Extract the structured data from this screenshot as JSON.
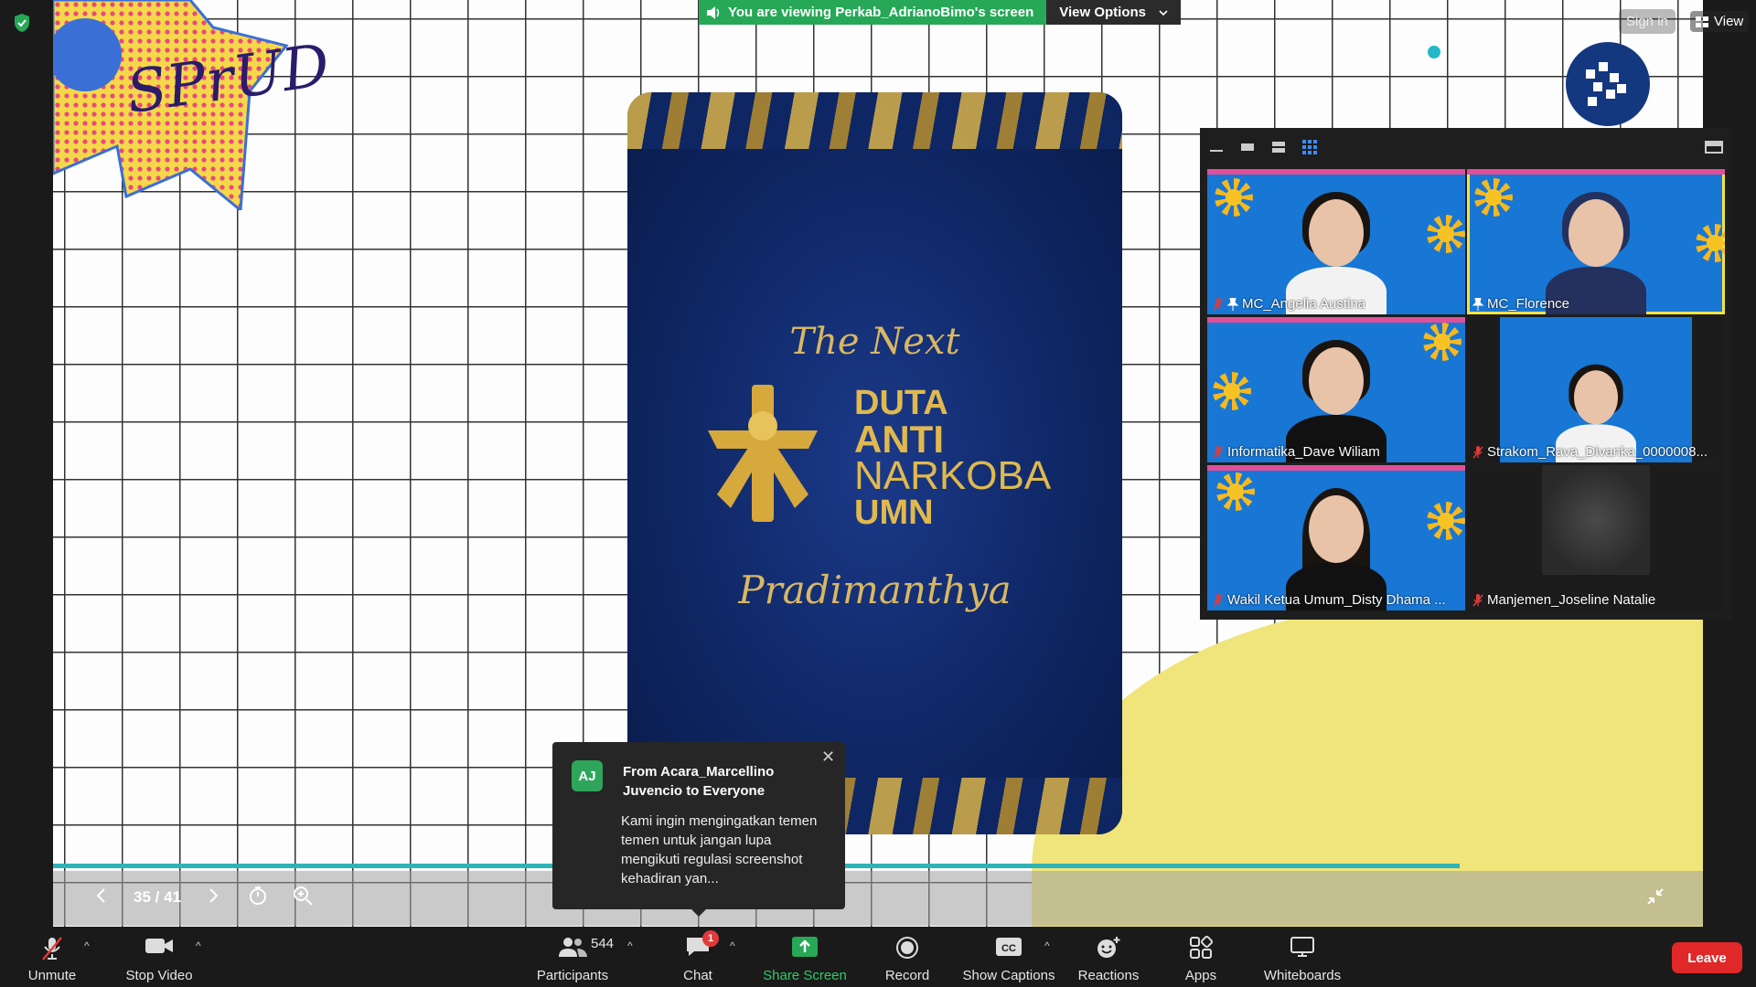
{
  "banner": {
    "viewing_text": "You are viewing Perkab_AdrianoBimo's screen",
    "view_options_label": "View Options"
  },
  "top_right": {
    "sign_in_label": "Sign in",
    "view_label": "View"
  },
  "poster": {
    "line_next": "The Next",
    "title_lines": [
      "DUTA",
      "ANTI",
      "NARKOBA",
      "UMN"
    ],
    "name": "Pradimanthya"
  },
  "gallery": {
    "participants": [
      {
        "name": "MC_Angelia Austina",
        "muted": true,
        "pinned": true,
        "active": false
      },
      {
        "name": "MC_Florence",
        "muted": false,
        "pinned": true,
        "active": true
      },
      {
        "name": "Informatika_Dave Wiliam",
        "muted": true,
        "pinned": false,
        "active": false
      },
      {
        "name": "Strakom_Rava_Divanka_0000008...",
        "muted": true,
        "pinned": false,
        "active": false
      },
      {
        "name": "Wakil Ketua Umum_Disty Dhama ...",
        "muted": true,
        "pinned": false,
        "active": false
      },
      {
        "name": "Manjemen_Joseline Natalie",
        "muted": true,
        "pinned": false,
        "active": false
      }
    ]
  },
  "slide_controls": {
    "page_count": "35 / 41"
  },
  "chat_toast": {
    "avatar_initials": "AJ",
    "from_text": "From Acara_Marcellino Juvencio to Everyone",
    "message": "Kami ingin mengingatkan temen temen untuk jangan lupa mengikuti regulasi screenshot kehadiran yan..."
  },
  "toolbar": {
    "unmute_label": "Unmute",
    "stop_video_label": "Stop Video",
    "participants_label": "Participants",
    "participants_count": "544",
    "chat_label": "Chat",
    "chat_badge": "1",
    "share_screen_label": "Share Screen",
    "record_label": "Record",
    "show_captions_label": "Show Captions",
    "reactions_label": "Reactions",
    "apps_label": "Apps",
    "whiteboards_label": "Whiteboards",
    "leave_label": "Leave"
  },
  "colors": {
    "share_green": "#26a857",
    "leave_red": "#e02828",
    "active_speaker": "#f0e34a",
    "tile_blue": "#1877d4"
  }
}
